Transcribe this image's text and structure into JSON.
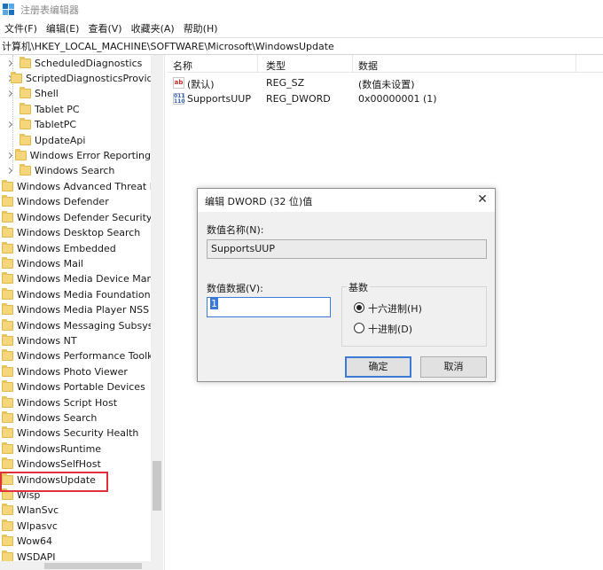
{
  "window": {
    "title": "注册表编辑器"
  },
  "menu": [
    "文件(F)",
    "编辑(E)",
    "查看(V)",
    "收藏夹(A)",
    "帮助(H)"
  ],
  "address": "计算机\\HKEY_LOCAL_MACHINE\\SOFTWARE\\Microsoft\\WindowsUpdate",
  "tree": {
    "sub_items": [
      "ScheduledDiagnostics",
      "ScriptedDiagnosticsProvide",
      "Shell",
      "Tablet PC",
      "TabletPC",
      "UpdateApi",
      "Windows Error Reporting",
      "Windows Search"
    ],
    "items": [
      "Windows Advanced Threat Pr",
      "Windows Defender",
      "Windows Defender Security C",
      "Windows Desktop Search",
      "Windows Embedded",
      "Windows Mail",
      "Windows Media Device Mana",
      "Windows Media Foundation",
      "Windows Media Player NSS",
      "Windows Messaging Subsyst",
      "Windows NT",
      "Windows Performance Toolki",
      "Windows Photo Viewer",
      "Windows Portable Devices",
      "Windows Script Host",
      "Windows Search",
      "Windows Security Health",
      "WindowsRuntime",
      "WindowsSelfHost",
      "WindowsUpdate",
      "Wisp",
      "WlanSvc",
      "Wlpasvc",
      "Wow64",
      "WSDAPI"
    ],
    "selected": "WindowsUpdate",
    "highlight_color": "#e0313a"
  },
  "list": {
    "columns": [
      "名称",
      "类型",
      "数据"
    ],
    "rows": [
      {
        "icon": "string-value-icon",
        "icon_text": "ab",
        "name": "(默认)",
        "type": "REG_SZ",
        "data": "(数值未设置)"
      },
      {
        "icon": "dword-value-icon",
        "icon_text": "011\n110",
        "name": "SupportsUUP",
        "type": "REG_DWORD",
        "data": "0x00000001 (1)"
      }
    ]
  },
  "dialog": {
    "title": "编辑 DWORD (32 位)值",
    "close": "✕",
    "value_name_label": "数值名称(N):",
    "value_name": "SupportsUUP",
    "value_data_label": "数值数据(V):",
    "value_data": "1",
    "base_label": "基数",
    "hex_label": "十六进制(H)",
    "dec_label": "十进制(D)",
    "base_selected": "hex",
    "ok": "确定",
    "cancel": "取消"
  }
}
